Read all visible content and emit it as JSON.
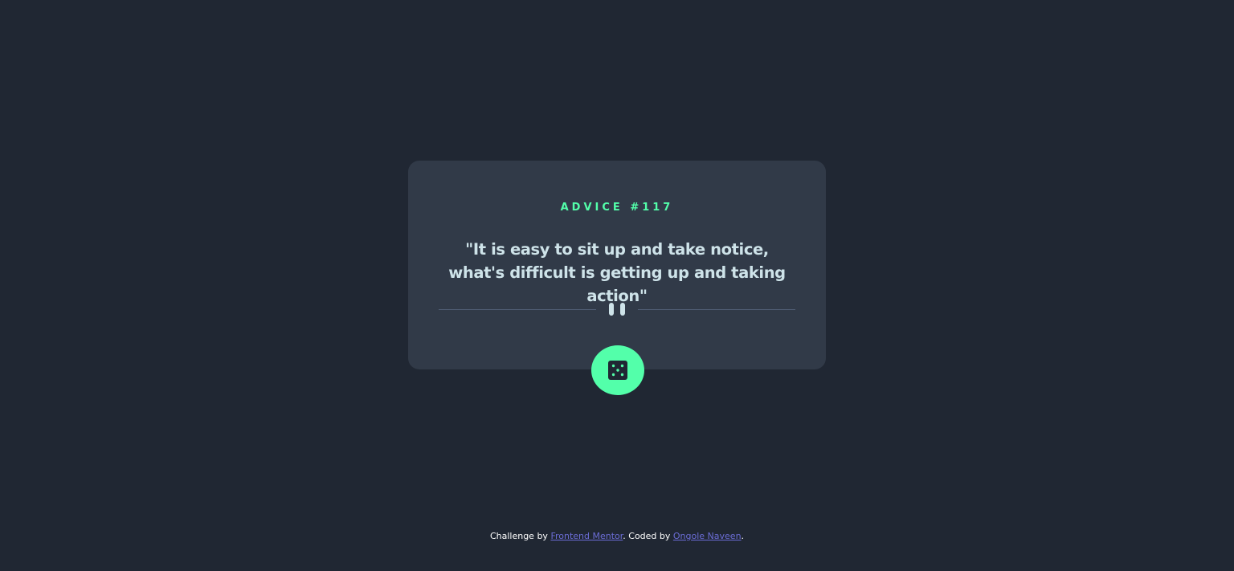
{
  "advice": {
    "label": "ADVICE #117",
    "quote": "\"It is easy to sit up and take notice, what's difficult is getting up and taking action\""
  },
  "icons": {
    "divider_icon": "pause-icon",
    "button_icon": "dice-icon"
  },
  "colors": {
    "background": "#202733",
    "card": "#313a48",
    "accent": "#53ffaa",
    "quote_text": "#cee3e9",
    "link": "#6b6dd6"
  },
  "footer": {
    "prefix": "Challenge by ",
    "link1": "Frontend Mentor",
    "middle": ". Coded by ",
    "link2": "Ongole Naveen",
    "suffix": "."
  }
}
